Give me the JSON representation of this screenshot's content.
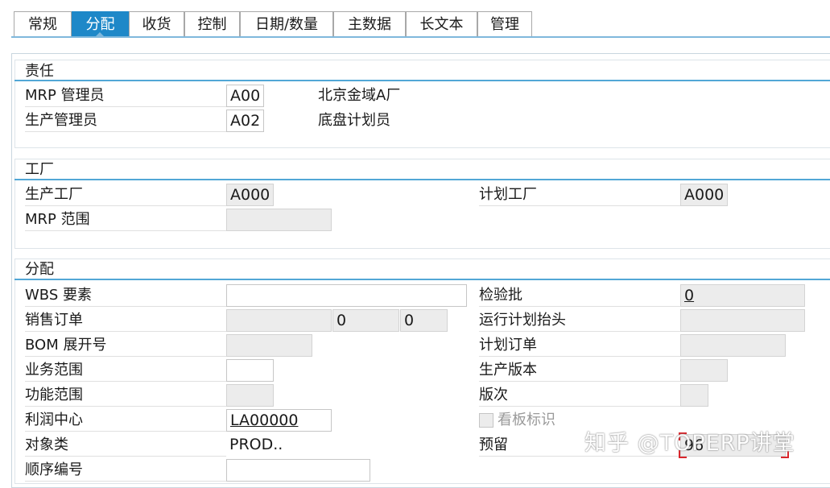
{
  "tabs": [
    {
      "label": "常规"
    },
    {
      "label": "分配"
    },
    {
      "label": "收货"
    },
    {
      "label": "控制"
    },
    {
      "label": "日期/数量"
    },
    {
      "label": "主数据"
    },
    {
      "label": "长文本"
    },
    {
      "label": "管理"
    }
  ],
  "responsibility": {
    "title": "责任",
    "mrp_controller_label": "MRP 管理员",
    "mrp_controller_value": "A00",
    "mrp_controller_desc": "北京金域A厂",
    "production_supervisor_label": "生产管理员",
    "production_supervisor_value": "A02",
    "production_supervisor_desc": "底盘计划员"
  },
  "plant": {
    "title": "工厂",
    "production_plant_label": "生产工厂",
    "production_plant_value": "A000",
    "planning_plant_label": "计划工厂",
    "planning_plant_value": "A000",
    "mrp_area_label": "MRP 范围",
    "mrp_area_value": ""
  },
  "assignment": {
    "title": "分配",
    "wbs_label": "WBS 要素",
    "wbs_value": "",
    "sales_order_label": "销售订单",
    "sales_order_value": "",
    "sales_order_item": "0",
    "sales_order_schedule": "0",
    "bom_explosion_label": "BOM 展开号",
    "bom_explosion_value": "",
    "business_area_label": "业务范围",
    "business_area_value": "",
    "functional_area_label": "功能范围",
    "functional_area_value": "",
    "profit_center_label": "利润中心",
    "profit_center_value": "LA00000",
    "object_class_label": "对象类",
    "object_class_value": "PROD..",
    "sequence_number_label": "顺序编号",
    "sequence_number_value": "",
    "inspection_lot_label": "检验批",
    "inspection_lot_value": "0",
    "run_schedule_header_label": "运行计划抬头",
    "run_schedule_header_value": "",
    "planned_order_label": "计划订单",
    "planned_order_value": "",
    "production_version_label": "生产版本",
    "production_version_value": "",
    "revision_label": "版次",
    "revision_value": "",
    "kanban_label": "看板标识",
    "reservation_label": "预留",
    "reservation_value": "96"
  },
  "watermark": "知乎 @TOPERP讲堂",
  "colors": {
    "active_tab": "#1e88c8",
    "group_line": "#52a7d6",
    "readonly_field": "#ececec"
  }
}
